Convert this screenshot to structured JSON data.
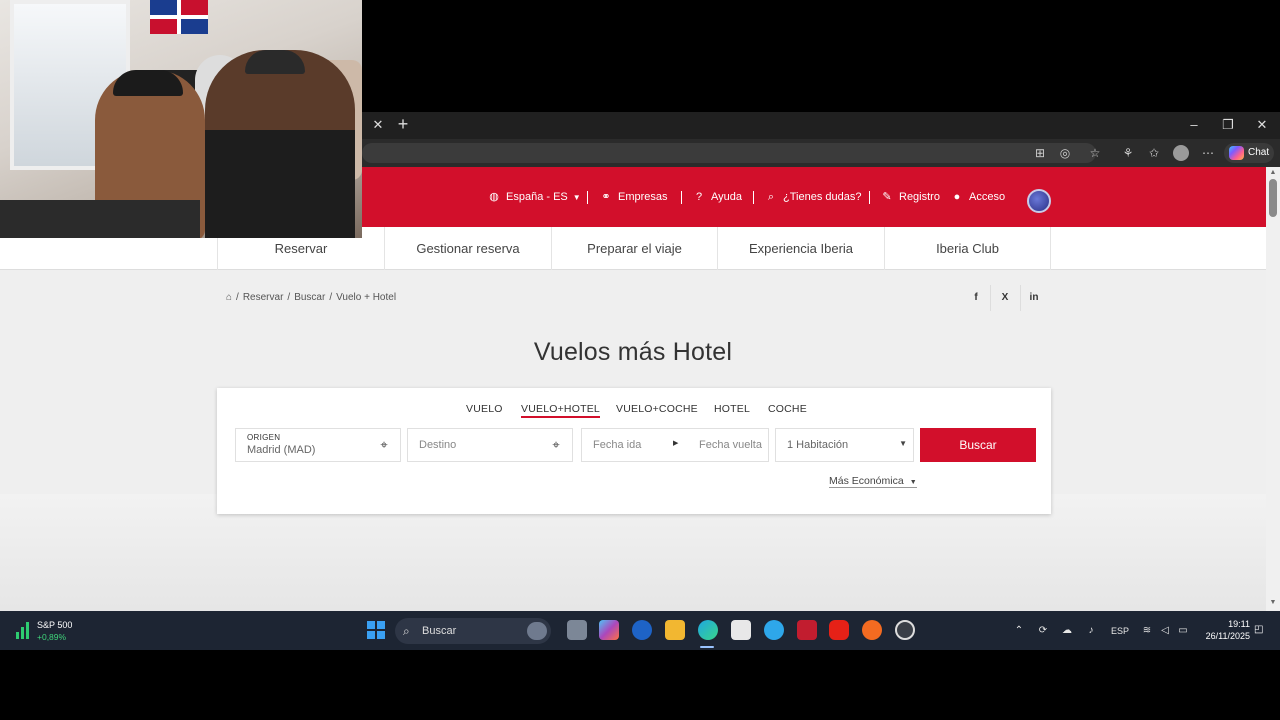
{
  "header": {
    "language": "España - ES",
    "links": [
      "Empresas",
      "Ayuda",
      "¿Tienes dudas?",
      "Registro",
      "Acceso"
    ]
  },
  "nav": {
    "items": [
      "Reservar",
      "Gestionar reserva",
      "Preparar el viaje",
      "Experiencia Iberia",
      "Iberia Club"
    ]
  },
  "breadcrumb": {
    "items": [
      "Reservar",
      "Buscar",
      "Vuelo + Hotel"
    ]
  },
  "share": [
    "f",
    "X",
    "in"
  ],
  "page": {
    "title": "Vuelos más Hotel"
  },
  "search": {
    "tabs": [
      "VUELO",
      "VUELO+HOTEL",
      "VUELO+COCHE",
      "HOTEL",
      "COCHE"
    ],
    "active_tab": "VUELO+HOTEL",
    "origin_label": "ORIGEN",
    "origin_value": "Madrid (MAD)",
    "destination_placeholder": "Destino",
    "departure_placeholder": "Fecha ida",
    "return_placeholder": "Fecha vuelta",
    "rooms_value": "1 Habitación",
    "button_label": "Buscar",
    "sort_value": "Más Económica"
  },
  "browser": {
    "chat_label": "Chat"
  },
  "taskbar": {
    "widget_title": "S&P 500",
    "widget_value": "+0,89%",
    "search_label": "Buscar",
    "language": "ESP",
    "time": "19:11",
    "date": "26/11/2025"
  },
  "colors": {
    "brand_red": "#d20f2b",
    "taskbar": "#1d2533"
  }
}
